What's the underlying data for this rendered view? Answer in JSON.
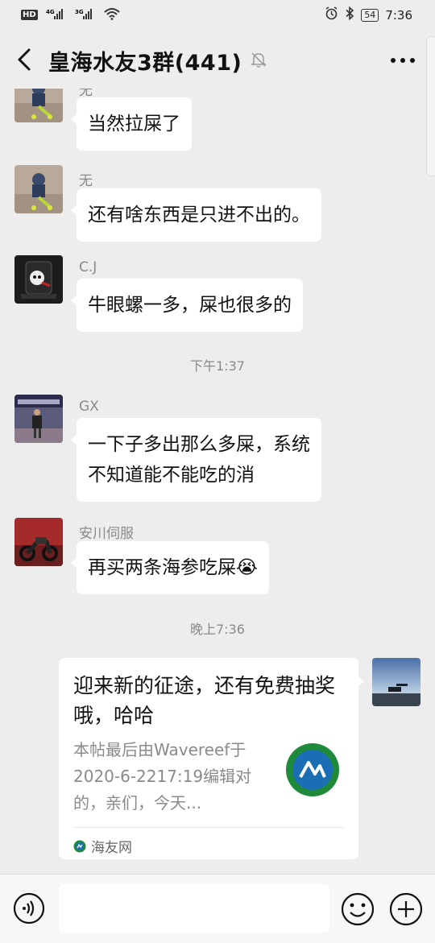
{
  "status_bar": {
    "left": [
      "HD",
      "4G",
      "3G",
      "wifi"
    ],
    "battery": "54",
    "time": "7:36"
  },
  "header": {
    "title": "皇海水友3群(441)"
  },
  "messages": [
    {
      "sender": "无",
      "text": "当然拉屎了",
      "avatar": "child-scooter-avatar"
    },
    {
      "sender": "无",
      "text": "还有啥东西是只进不出的。",
      "avatar": "child-scooter-avatar"
    },
    {
      "sender": "C.J",
      "text": "牛眼螺一多，屎也很多的",
      "avatar": "cj-avatar"
    },
    {
      "time": "下午1:37"
    },
    {
      "sender": "GX",
      "lines": [
        "一下子多出那么多屎，系统",
        "不知道能不能吃的消"
      ],
      "avatar": "gx-avatar"
    },
    {
      "sender": "安川伺服",
      "text": "再买两条海参吃屎😭",
      "avatar": "motorcycle-avatar"
    },
    {
      "time": "晚上7:36"
    }
  ],
  "link_card": {
    "title": "迎来新的征途，还有免费抽奖哦，哈哈",
    "desc": "本帖最后由Wavereef于2020-6-2217:19编辑对的，亲们，今天...",
    "source": "海友网",
    "colors": {
      "logo": "#1a6fb4",
      "logo_ring": "#1f8a3a"
    }
  },
  "input_bar": {
    "placeholder": ""
  }
}
